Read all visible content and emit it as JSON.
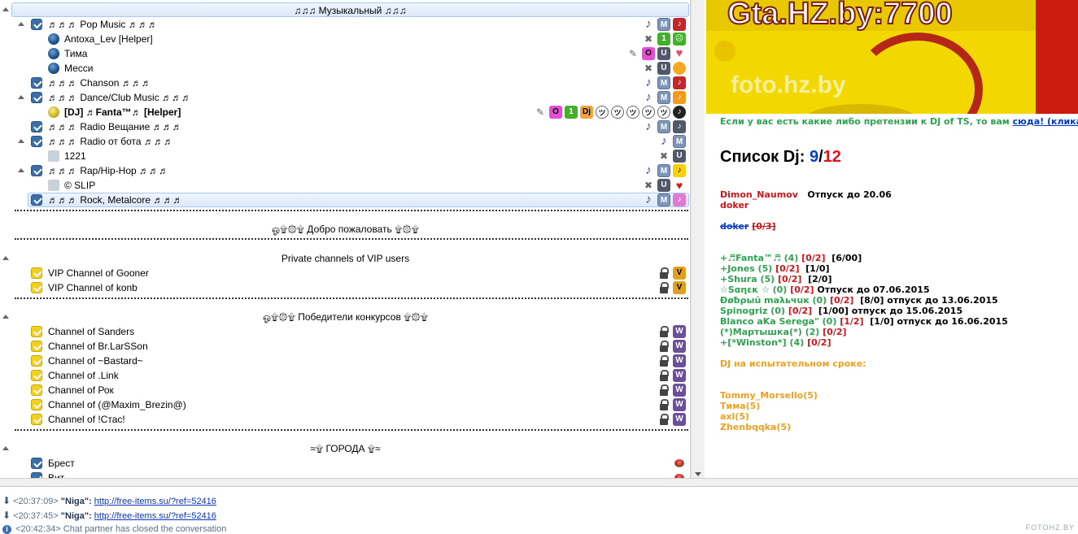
{
  "tree": {
    "root_label": "♫♫♫ Музыкальный ♫♫♫",
    "music_channels": [
      {
        "label": "♬♬♬ Pop Music ♬♬♬"
      },
      {
        "label": "Antoxa_Lev [Helper]"
      },
      {
        "label": "Тима"
      },
      {
        "label": "Месси"
      },
      {
        "label": "♬♬♬ Chanson ♬♬♬"
      },
      {
        "label": "♬♬♬ Dance/Club Music ♬♬♬"
      },
      {
        "label": "[DJ] ♬Fanta™♬ [Helper]"
      },
      {
        "label": "♬♬♬ Radio Вещание ♬♬♬"
      },
      {
        "label": "♬♬♬ Radio от бота ♬♬♬"
      },
      {
        "label": "1221"
      },
      {
        "label": "♬♬♬ Rap/Hip-Hop ♬♬♬"
      },
      {
        "label": "© SLIP"
      },
      {
        "label": "♬♬♬ Rock, Metalcore ♬♬♬"
      }
    ],
    "welcome_label": "ஓ۩۞۩ Добро пожаловать ۩۞۩",
    "private_label": "Private channels of VIP users",
    "vip_channels": [
      "VIP Channel of Gooner",
      "VIP Channel of konb"
    ],
    "winners_label": "ஓ۩۞۩ Победители конкурсов ۩۞۩",
    "winner_channels": [
      "Channel of Sanders",
      "Channel of Br.LarSSon",
      "Channel of ~Bastard~",
      "Channel of .Link",
      "Channel of Рок",
      "Channel of (@Maxim_Brezin@)",
      "Channel of !Стас!"
    ],
    "cities_label": "≈۩ ГОРОДА ۩≈",
    "city_channels": [
      "Брест",
      "Вит..."
    ]
  },
  "badges": {
    "M": "M",
    "U": "U",
    "V": "V",
    "W": "W",
    "one": "1",
    "O": "O",
    "DJ": "Dj"
  },
  "banner": {
    "domain": "Gta.HZ.by:7700",
    "photo": "foto.hz.by"
  },
  "info": {
    "notice_text": "Если у вас есть какие либо претензии к DJ of TS, то вам",
    "notice_link": "сюда! (кликабельн",
    "dj_title": "Список Dj:",
    "dj_count": "9",
    "dj_slash": "/",
    "dj_total": "12",
    "vacation_name": "Dimon_Naumov",
    "vacation_text": "Отпуск до 20.06",
    "doker": "doker",
    "doker_strike": "doker",
    "doker_counts": "[0/3]",
    "list": [
      {
        "name": "+♬Fanta™♬ (4)",
        "slot": "[0/2]",
        "extra": "[6/00]"
      },
      {
        "name": "+Jones (5)",
        "slot": "[0/2]",
        "extra": "[1/0]"
      },
      {
        "name": "+Shura  (5)",
        "slot": "[0/2]",
        "extra": "[2/0]"
      },
      {
        "name": "☆Sαηεκ ☆ (0)",
        "slot": "[0/2]",
        "extra": "Отпуск до 07.06.2015"
      },
      {
        "name": "Ðøƀρыŭ maλьчuĸ (0)",
        "slot": "[0/2]",
        "extra": "[8/0] отпуск до 13.06.2015"
      },
      {
        "name": "Spinogriz (0)",
        "slot": "[0/2]",
        "extra": "[1/00] отпуск до 15.06.2015"
      },
      {
        "name": "Blanco aKa Serega\" (0)",
        "slot": "[1/2]",
        "extra": "[1/0] отпуск до 16.06.2015"
      },
      {
        "name": "(*)Мартышка(*)  (2)",
        "slot": "[0/2]",
        "extra": ""
      },
      {
        "name": "+[*Winston*] (4)",
        "slot": "[0/2]",
        "extra": ""
      }
    ],
    "trial_title": "DJ на испытательном сроке:",
    "trial": [
      "Tommy_Morsello(5)",
      "Тима(5)",
      "axl(5)",
      "Zhenbqqka(5)"
    ]
  },
  "chat": [
    {
      "time": "<20:37:09>",
      "nick": "\"Niga\":",
      "link": "http://free-items.su/?ref=52416"
    },
    {
      "time": "<20:37:45>",
      "nick": "\"Niga\":",
      "link": "http://free-items.su/?ref=52416"
    },
    {
      "time": "<20:42:34>",
      "text": "Chat partner has closed the conversation"
    }
  ],
  "watermark": "FOTOHZ.BY",
  "colors": {
    "accent_blue": "#0b3cc4",
    "accent_red": "#e0121a",
    "green": "#2da24f",
    "orange": "#f0a020",
    "banner_yellow": "#f3d800"
  }
}
